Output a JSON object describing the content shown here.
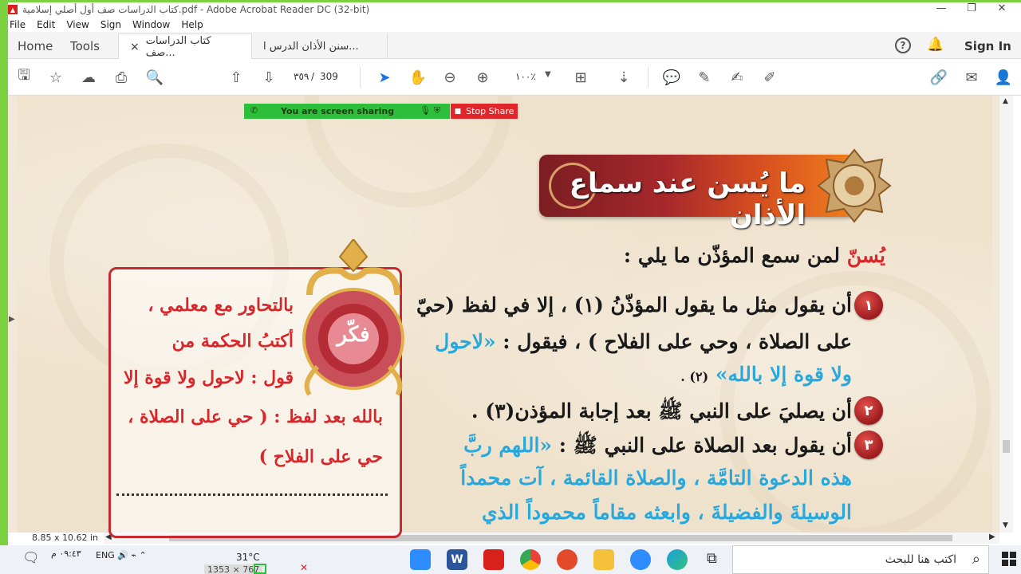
{
  "window": {
    "title": "كتاب الدراسات صف أول أصلي إسلامية.pdf - Adobe Acrobat Reader DC (32-bit)",
    "minimize": "—",
    "maximize": "❐",
    "close": "✕"
  },
  "menu": [
    "File",
    "Edit",
    "View",
    "Sign",
    "Window",
    "Help"
  ],
  "nav": {
    "home": "Home",
    "tools": "Tools",
    "sign_in": "Sign In"
  },
  "tabs": [
    {
      "label": "كتاب الدراسات صف...",
      "close": "×"
    },
    {
      "label": "سنن الأذان الدرس ا..."
    }
  ],
  "toolbar": {
    "page_current": "٣٥٩",
    "page_separator": "/",
    "page_total": "309",
    "zoom": "١٠٠٪"
  },
  "share": {
    "status": "You are screen sharing",
    "stop_label": "Stop Share"
  },
  "lesson": {
    "heading": "ما يُسن عند سماع الأذان",
    "intro_highlight": "يُسنّ",
    "intro_rest": "لمن سمع المؤذّن ما يلي :",
    "items": [
      {
        "num": "١",
        "line1": "أن يقول مثل ما يقول المؤذّنُ (١) ، إلا في لفظ (حيّ",
        "line2_black": "على الصلاة ، وحي على الفلاح ) ، فيقول :",
        "line2_blue": "«لاحول",
        "line3_blue": "ولا قوة إلا بالله»",
        "line3_black": "(٢) ."
      },
      {
        "num": "٢",
        "line1": "أن يصليَ على النبي ﷺ بعد إجابة المؤذن(٣) ."
      },
      {
        "num": "٣",
        "line1_black": "أن يقول بعد الصلاة على النبي ﷺ :",
        "line1_blue": "«اللهم ربَّ",
        "line2": "هذه الدعوة التامَّة ، والصلاة القائمة ، آت محمداً",
        "line3": "الوسيلةَ والفضيلةَ ، وابعثه مقاماً محموداً الذي"
      }
    ]
  },
  "think": {
    "badge": "فكّر",
    "lines": [
      "بالتحاور مع معلمي ،",
      "أكتبُ الحكمة من",
      "قول : لاحول ولا قوة إلا",
      "بالله بعد لفظ : ( حي على الصلاة ،",
      "حي على الفلاح )"
    ]
  },
  "status": {
    "page_size": "8.85 x 10.62 in"
  },
  "taskbar": {
    "search_placeholder": "اكتب هنا للبحث",
    "clock": "٠٩:٤٣ م",
    "weather": "31°C",
    "resolution": "1353 × 767"
  }
}
